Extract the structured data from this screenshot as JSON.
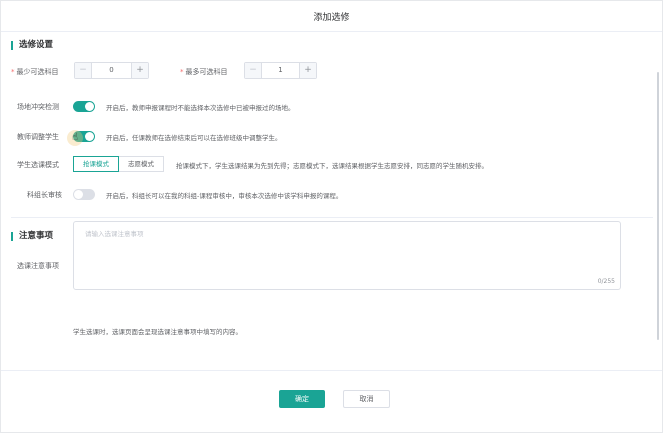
{
  "dialog": {
    "title": "添加选修"
  },
  "section1": {
    "title": "选修设置",
    "min_label": "最少可选科目",
    "min_value": "0",
    "max_label": "最多可选科目",
    "max_value": "1",
    "minus": "−",
    "plus": "+",
    "required_mark": "*"
  },
  "rows": [
    {
      "label": "场地冲突检测",
      "switch_on": true,
      "hint": "开启后，教师申报课程时不能选择本次选修中已被申报过的场地。"
    },
    {
      "label": "教师调整学生",
      "switch_on": true,
      "hint": "开启后，任课教师在选修结束后可以在选修班级中调整学生。"
    },
    {
      "label": "学生选课模式",
      "options": [
        "抢课模式",
        "志愿模式"
      ],
      "selected": "抢课模式",
      "hint": "抢课模式下，学生选课结果为先到先得；志愿模式下，选课结果根据学生志愿安排，同志愿的学生随机安排。"
    },
    {
      "label": "科组长审核",
      "switch_on": false,
      "hint": "开启后，科组长可以在我的科组-课程审核中，审核本次选修中该学科申报的课程。"
    }
  ],
  "section2": {
    "title": "注意事项",
    "field_label": "选课注意事项",
    "placeholder": "请输入选课注意事项",
    "counter": "0/255",
    "tip": "学生选课时，选课页面会呈现选课注意事项中填写的内容。"
  },
  "footer": {
    "confirm": "确定",
    "cancel": "取消"
  },
  "colors": {
    "accent": "#1aa495",
    "required": "#f56c6c"
  },
  "icons": {
    "cursor": "hand-pointer-icon"
  }
}
